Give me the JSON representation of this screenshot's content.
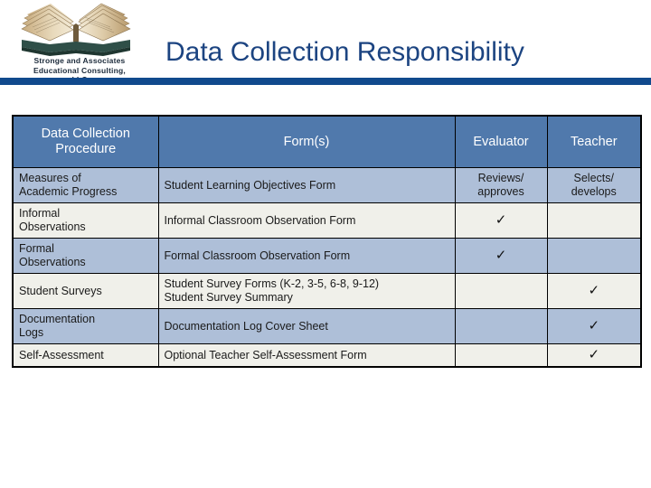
{
  "slide": {
    "title": "Data Collection Responsibility",
    "logo": {
      "icon": "open-book-icon",
      "caption_line1": "Stronge and Associates",
      "caption_line2": "Educational Consulting,",
      "caption_line3": "LLC"
    },
    "colors": {
      "title_text": "#1c4481",
      "rule_bar": "#114a8d",
      "table_header_bg": "#5079ac",
      "row_band_blue": "#aebfd8",
      "row_band_light": "#f0f0ea",
      "border": "#000000"
    }
  },
  "table": {
    "columns": [
      "Data Collection Procedure",
      "Form(s)",
      "Evaluator",
      "Teacher"
    ],
    "rows": [
      {
        "procedure_line1": "Measures of",
        "procedure_line2": "Academic Progress",
        "forms_line1": "Student Learning Objectives Form",
        "forms_line2": "",
        "evaluator_line1": "Reviews/",
        "evaluator_line2": "approves",
        "teacher_line1": "Selects/",
        "teacher_line2": "develops"
      },
      {
        "procedure_line1": "Informal",
        "procedure_line2": "Observations",
        "forms_line1": "Informal Classroom Observation Form",
        "forms_line2": "",
        "evaluator_line1": "✓",
        "evaluator_line2": "",
        "teacher_line1": "",
        "teacher_line2": ""
      },
      {
        "procedure_line1": "Formal",
        "procedure_line2": "Observations",
        "forms_line1": "Formal Classroom Observation Form",
        "forms_line2": "",
        "evaluator_line1": "✓",
        "evaluator_line2": "",
        "teacher_line1": "",
        "teacher_line2": ""
      },
      {
        "procedure_line1": "Student Surveys",
        "procedure_line2": "",
        "forms_line1": "Student Survey Forms (K-2, 3-5, 6-8, 9-12)",
        "forms_line2": "Student Survey Summary",
        "evaluator_line1": "",
        "evaluator_line2": "",
        "teacher_line1": "✓",
        "teacher_line2": ""
      },
      {
        "procedure_line1": "Documentation",
        "procedure_line2": "Logs",
        "forms_line1": "Documentation Log Cover Sheet",
        "forms_line2": "",
        "evaluator_line1": "",
        "evaluator_line2": "",
        "teacher_line1": "✓",
        "teacher_line2": ""
      },
      {
        "procedure_line1": "Self-Assessment",
        "procedure_line2": "",
        "forms_line1": "Optional Teacher Self-Assessment Form",
        "forms_line2": "",
        "evaluator_line1": "",
        "evaluator_line2": "",
        "teacher_line1": "✓",
        "teacher_line2": ""
      }
    ]
  }
}
